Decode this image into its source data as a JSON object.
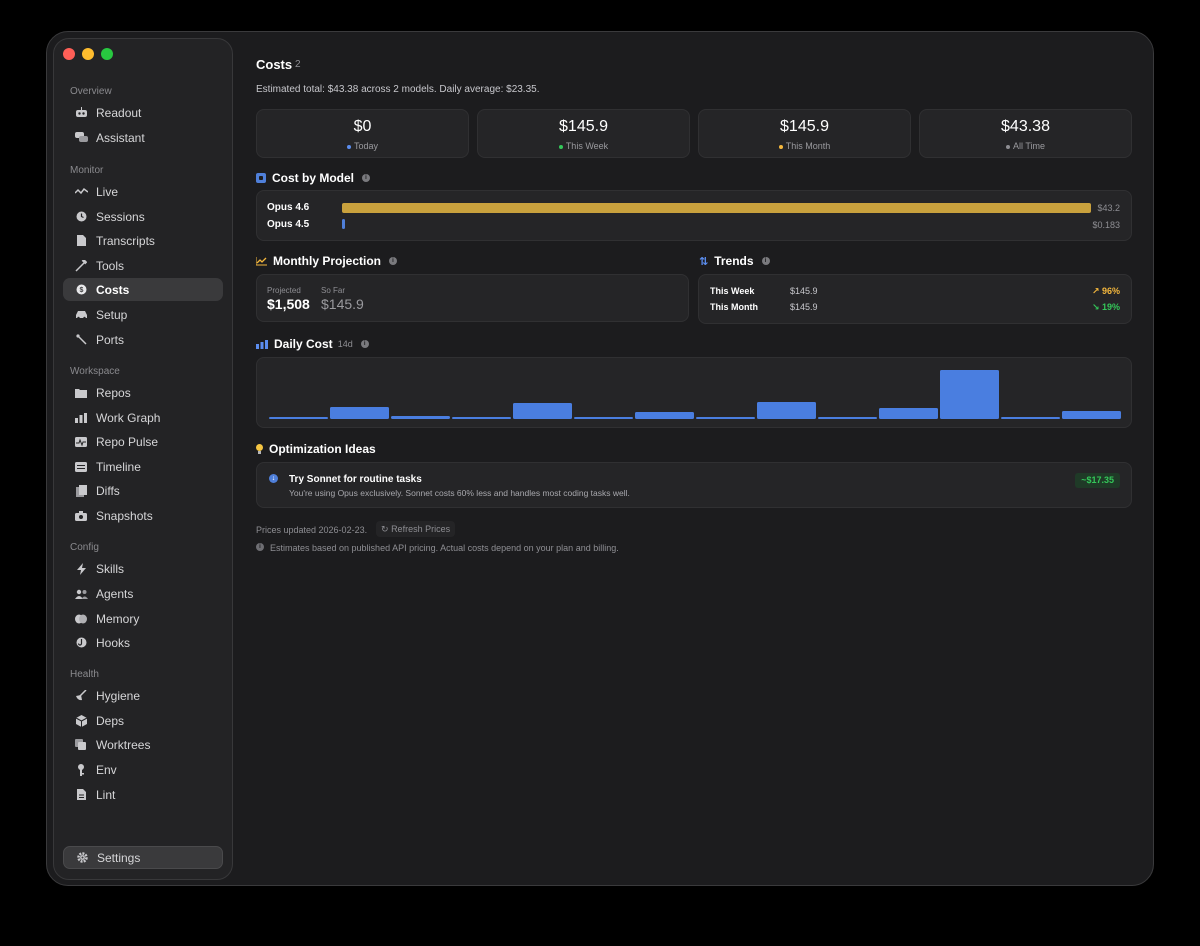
{
  "sidebar": {
    "sections": [
      {
        "title": "Overview",
        "items": [
          {
            "label": "Readout",
            "icon": "robot-icon"
          },
          {
            "label": "Assistant",
            "icon": "chat-icon"
          }
        ]
      },
      {
        "title": "Monitor",
        "items": [
          {
            "label": "Live",
            "icon": "pulse-icon"
          },
          {
            "label": "Sessions",
            "icon": "clock-icon"
          },
          {
            "label": "Transcripts",
            "icon": "document-icon"
          },
          {
            "label": "Tools",
            "icon": "hammer-icon"
          },
          {
            "label": "Costs",
            "icon": "dollar-icon",
            "active": true
          },
          {
            "label": "Setup",
            "icon": "car-icon"
          },
          {
            "label": "Ports",
            "icon": "plug-icon"
          }
        ]
      },
      {
        "title": "Workspace",
        "items": [
          {
            "label": "Repos",
            "icon": "folder-icon"
          },
          {
            "label": "Work Graph",
            "icon": "bar-chart-icon"
          },
          {
            "label": "Repo Pulse",
            "icon": "waveform-icon"
          },
          {
            "label": "Timeline",
            "icon": "list-icon"
          },
          {
            "label": "Diffs",
            "icon": "diff-icon"
          },
          {
            "label": "Snapshots",
            "icon": "camera-icon"
          }
        ]
      },
      {
        "title": "Config",
        "items": [
          {
            "label": "Skills",
            "icon": "bolt-icon"
          },
          {
            "label": "Agents",
            "icon": "people-icon"
          },
          {
            "label": "Memory",
            "icon": "brain-icon"
          },
          {
            "label": "Hooks",
            "icon": "hook-icon"
          }
        ]
      },
      {
        "title": "Health",
        "items": [
          {
            "label": "Hygiene",
            "icon": "broom-icon"
          },
          {
            "label": "Deps",
            "icon": "cube-icon"
          },
          {
            "label": "Worktrees",
            "icon": "stack-icon"
          },
          {
            "label": "Env",
            "icon": "key-icon"
          },
          {
            "label": "Lint",
            "icon": "checklist-icon"
          }
        ]
      }
    ],
    "settings_label": "Settings"
  },
  "header": {
    "title": "Costs",
    "badge": "2",
    "summary": "Estimated total: $43.38 across 2 models. Daily average: $23.35."
  },
  "stats": [
    {
      "value": "$0",
      "label": "Today",
      "color": "#5b8def"
    },
    {
      "value": "$145.9",
      "label": "This Week",
      "color": "#34c759"
    },
    {
      "value": "$145.9",
      "label": "This Month",
      "color": "#f5b83d"
    },
    {
      "value": "$43.38",
      "label": "All Time",
      "color": "#8e8e93"
    }
  ],
  "cost_by_model": {
    "title": "Cost by Model",
    "models": [
      {
        "name": "Opus 4.6",
        "value": 43.2,
        "value_label": "$43.2",
        "color": "#c9a13d"
      },
      {
        "name": "Opus 4.5",
        "value": 0.183,
        "value_label": "$0.183",
        "color": "#4f7fd9"
      }
    ]
  },
  "projection": {
    "title": "Monthly Projection",
    "projected_label": "Projected",
    "projected_value": "$1,508",
    "sofar_label": "So Far",
    "sofar_value": "$145.9"
  },
  "trends": {
    "title": "Trends",
    "rows": [
      {
        "label": "This Week",
        "value": "$145.9",
        "change": "↗ 96%",
        "color": "#f5b83d"
      },
      {
        "label": "This Month",
        "value": "$145.9",
        "change": "↘ 19%",
        "color": "#34c759"
      }
    ]
  },
  "daily_cost": {
    "title": "Daily Cost",
    "range": "14d"
  },
  "chart_data": {
    "type": "bar",
    "title": "Daily Cost",
    "values": [
      2,
      12,
      3,
      2,
      16,
      2,
      7,
      2,
      17,
      2,
      11,
      49,
      2,
      8
    ],
    "ylim": [
      0,
      50
    ],
    "color": "#4a7ee0"
  },
  "optimization": {
    "title": "Optimization Ideas",
    "tip_title": "Try Sonnet for routine tasks",
    "tip_body": "You're using Opus exclusively. Sonnet costs 60% less and handles most coding tasks well.",
    "savings": "~$17.35"
  },
  "footer": {
    "prices_updated": "Prices updated 2026-02-23.",
    "refresh_label": "Refresh Prices",
    "disclaimer": "Estimates based on published API pricing. Actual costs depend on your plan and billing."
  }
}
